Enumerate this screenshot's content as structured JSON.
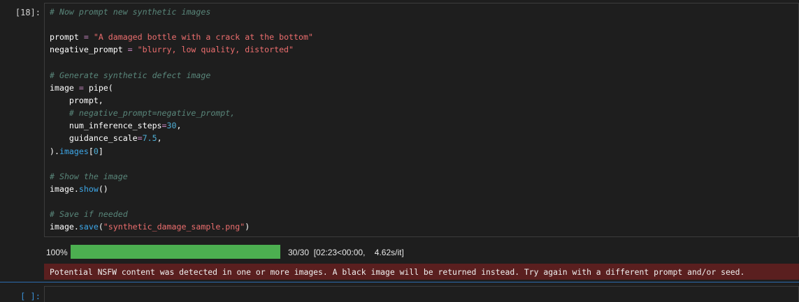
{
  "cell_18": {
    "prompt_label": "[18]:",
    "code_lines": [
      [
        {
          "t": "# Now prompt new synthetic images",
          "c": "comment"
        }
      ],
      [],
      [
        {
          "t": "prompt",
          "c": "plain"
        },
        {
          "t": " = ",
          "c": "op"
        },
        {
          "t": "\"A damaged bottle with a crack at the bottom\"",
          "c": "string"
        }
      ],
      [
        {
          "t": "negative_prompt",
          "c": "plain"
        },
        {
          "t": " = ",
          "c": "op"
        },
        {
          "t": "\"blurry, low quality, distorted\"",
          "c": "string"
        }
      ],
      [],
      [
        {
          "t": "# Generate synthetic defect image",
          "c": "comment"
        }
      ],
      [
        {
          "t": "image",
          "c": "plain"
        },
        {
          "t": " = ",
          "c": "op"
        },
        {
          "t": "pipe(",
          "c": "plain"
        }
      ],
      [
        {
          "t": "    prompt,",
          "c": "plain"
        }
      ],
      [
        {
          "t": "    # negative_prompt=negative_prompt,",
          "c": "comment"
        }
      ],
      [
        {
          "t": "    num_inference_steps",
          "c": "plain"
        },
        {
          "t": "=",
          "c": "op"
        },
        {
          "t": "30",
          "c": "num"
        },
        {
          "t": ",",
          "c": "plain"
        }
      ],
      [
        {
          "t": "    guidance_scale",
          "c": "plain"
        },
        {
          "t": "=",
          "c": "op"
        },
        {
          "t": "7.5",
          "c": "num"
        },
        {
          "t": ",",
          "c": "plain"
        }
      ],
      [
        {
          "t": ").",
          "c": "plain"
        },
        {
          "t": "images",
          "c": "attr"
        },
        {
          "t": "[",
          "c": "plain"
        },
        {
          "t": "0",
          "c": "num"
        },
        {
          "t": "]",
          "c": "plain"
        }
      ],
      [],
      [
        {
          "t": "# Show the image",
          "c": "comment"
        }
      ],
      [
        {
          "t": "image.",
          "c": "plain"
        },
        {
          "t": "show",
          "c": "attr"
        },
        {
          "t": "()",
          "c": "plain"
        }
      ],
      [],
      [
        {
          "t": "# Save if needed",
          "c": "comment"
        }
      ],
      [
        {
          "t": "image.",
          "c": "plain"
        },
        {
          "t": "save",
          "c": "attr"
        },
        {
          "t": "(",
          "c": "plain"
        },
        {
          "t": "\"synthetic_damage_sample.png\"",
          "c": "string"
        },
        {
          "t": ")",
          "c": "plain"
        }
      ]
    ]
  },
  "progress": {
    "percent_label": "100%",
    "fraction": 1.0,
    "stats": "30/30  [02:23<00:00,    4.62s/it]",
    "bar_color": "#4caf50"
  },
  "stderr_message": "Potential NSFW content was detected in one or more images. A black image will be returned instead. Try again with a different prompt and/or seed.",
  "empty_cell": {
    "prompt_label": "[ ]:"
  },
  "colors": {
    "comment": "#59867a",
    "string": "#ec6e6e",
    "number": "#4fb0d8",
    "attribute": "#3da7e8",
    "operator": "#c586c0",
    "stderr_bg": "#5a1f1f",
    "active_cell_border": "#2b6cb0"
  }
}
